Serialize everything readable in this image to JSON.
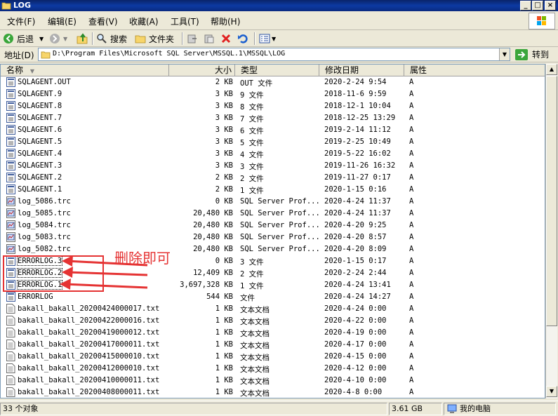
{
  "window": {
    "title": "LOG"
  },
  "menu": [
    "文件(F)",
    "编辑(E)",
    "查看(V)",
    "收藏(A)",
    "工具(T)",
    "帮助(H)"
  ],
  "toolbar": {
    "back": "后退",
    "search": "搜索",
    "folders": "文件夹"
  },
  "address": {
    "label": "地址(D)",
    "path": "D:\\Program Files\\Microsoft SQL Server\\MSSQL.1\\MSSQL\\LOG",
    "go": "转到"
  },
  "columns": {
    "name": "名称",
    "size": "大小",
    "type": "类型",
    "modified": "修改日期",
    "attr": "属性"
  },
  "files": [
    {
      "name": "SQLAGENT.OUT",
      "size": "2 KB",
      "type": "OUT 文件",
      "modified": "2020-2-24 9:54",
      "attr": "A",
      "icon": "log"
    },
    {
      "name": "SQLAGENT.9",
      "size": "3 KB",
      "type": "9 文件",
      "modified": "2018-11-6 9:59",
      "attr": "A",
      "icon": "log"
    },
    {
      "name": "SQLAGENT.8",
      "size": "3 KB",
      "type": "8 文件",
      "modified": "2018-12-1 10:04",
      "attr": "A",
      "icon": "log"
    },
    {
      "name": "SQLAGENT.7",
      "size": "3 KB",
      "type": "7 文件",
      "modified": "2018-12-25 13:29",
      "attr": "A",
      "icon": "log"
    },
    {
      "name": "SQLAGENT.6",
      "size": "3 KB",
      "type": "6 文件",
      "modified": "2019-2-14 11:12",
      "attr": "A",
      "icon": "log"
    },
    {
      "name": "SQLAGENT.5",
      "size": "3 KB",
      "type": "5 文件",
      "modified": "2019-2-25 10:49",
      "attr": "A",
      "icon": "log"
    },
    {
      "name": "SQLAGENT.4",
      "size": "3 KB",
      "type": "4 文件",
      "modified": "2019-5-22 16:02",
      "attr": "A",
      "icon": "log"
    },
    {
      "name": "SQLAGENT.3",
      "size": "3 KB",
      "type": "3 文件",
      "modified": "2019-11-26 16:32",
      "attr": "A",
      "icon": "log"
    },
    {
      "name": "SQLAGENT.2",
      "size": "2 KB",
      "type": "2 文件",
      "modified": "2019-11-27 0:17",
      "attr": "A",
      "icon": "log"
    },
    {
      "name": "SQLAGENT.1",
      "size": "2 KB",
      "type": "1 文件",
      "modified": "2020-1-15 0:16",
      "attr": "A",
      "icon": "log"
    },
    {
      "name": "log_5086.trc",
      "size": "0 KB",
      "type": "SQL Server Prof...",
      "modified": "2020-4-24 11:37",
      "attr": "A",
      "icon": "trc"
    },
    {
      "name": "log_5085.trc",
      "size": "20,480 KB",
      "type": "SQL Server Prof...",
      "modified": "2020-4-24 11:37",
      "attr": "A",
      "icon": "trc"
    },
    {
      "name": "log_5084.trc",
      "size": "20,480 KB",
      "type": "SQL Server Prof...",
      "modified": "2020-4-20 9:25",
      "attr": "A",
      "icon": "trc"
    },
    {
      "name": "log_5083.trc",
      "size": "20,480 KB",
      "type": "SQL Server Prof...",
      "modified": "2020-4-20 8:57",
      "attr": "A",
      "icon": "trc"
    },
    {
      "name": "log_5082.trc",
      "size": "20,480 KB",
      "type": "SQL Server Prof...",
      "modified": "2020-4-20 8:09",
      "attr": "A",
      "icon": "trc"
    },
    {
      "name": "ERRORLOG.3",
      "size": "0 KB",
      "type": "3 文件",
      "modified": "2020-1-15 0:17",
      "attr": "A",
      "icon": "log"
    },
    {
      "name": "ERRORLOG.2",
      "size": "12,409 KB",
      "type": "2 文件",
      "modified": "2020-2-24 2:44",
      "attr": "A",
      "icon": "log"
    },
    {
      "name": "ERRORLOG.1",
      "size": "3,697,328 KB",
      "type": "1 文件",
      "modified": "2020-4-24 13:41",
      "attr": "A",
      "icon": "log"
    },
    {
      "name": "ERRORLOG",
      "size": "544 KB",
      "type": "文件",
      "modified": "2020-4-24 14:27",
      "attr": "A",
      "icon": "log"
    },
    {
      "name": "bakall_bakall_20200424000017.txt",
      "size": "1 KB",
      "type": "文本文档",
      "modified": "2020-4-24 0:00",
      "attr": "A",
      "icon": "txt"
    },
    {
      "name": "bakall_bakall_20200422000016.txt",
      "size": "1 KB",
      "type": "文本文档",
      "modified": "2020-4-22 0:00",
      "attr": "A",
      "icon": "txt"
    },
    {
      "name": "bakall_bakall_20200419000012.txt",
      "size": "1 KB",
      "type": "文本文档",
      "modified": "2020-4-19 0:00",
      "attr": "A",
      "icon": "txt"
    },
    {
      "name": "bakall_bakall_20200417000011.txt",
      "size": "1 KB",
      "type": "文本文档",
      "modified": "2020-4-17 0:00",
      "attr": "A",
      "icon": "txt"
    },
    {
      "name": "bakall_bakall_20200415000010.txt",
      "size": "1 KB",
      "type": "文本文档",
      "modified": "2020-4-15 0:00",
      "attr": "A",
      "icon": "txt"
    },
    {
      "name": "bakall_bakall_20200412000010.txt",
      "size": "1 KB",
      "type": "文本文档",
      "modified": "2020-4-12 0:00",
      "attr": "A",
      "icon": "txt"
    },
    {
      "name": "bakall_bakall_20200410000011.txt",
      "size": "1 KB",
      "type": "文本文档",
      "modified": "2020-4-10 0:00",
      "attr": "A",
      "icon": "txt"
    },
    {
      "name": "bakall_bakall_20200408000011.txt",
      "size": "1 KB",
      "type": "文本文档",
      "modified": "2020-4-8 0:00",
      "attr": "A",
      "icon": "txt"
    }
  ],
  "annotation": {
    "text": "删除即可",
    "color": "#e53333"
  },
  "status": {
    "count": "33 个对象",
    "free": "3.61 GB",
    "location": "我的电脑"
  }
}
